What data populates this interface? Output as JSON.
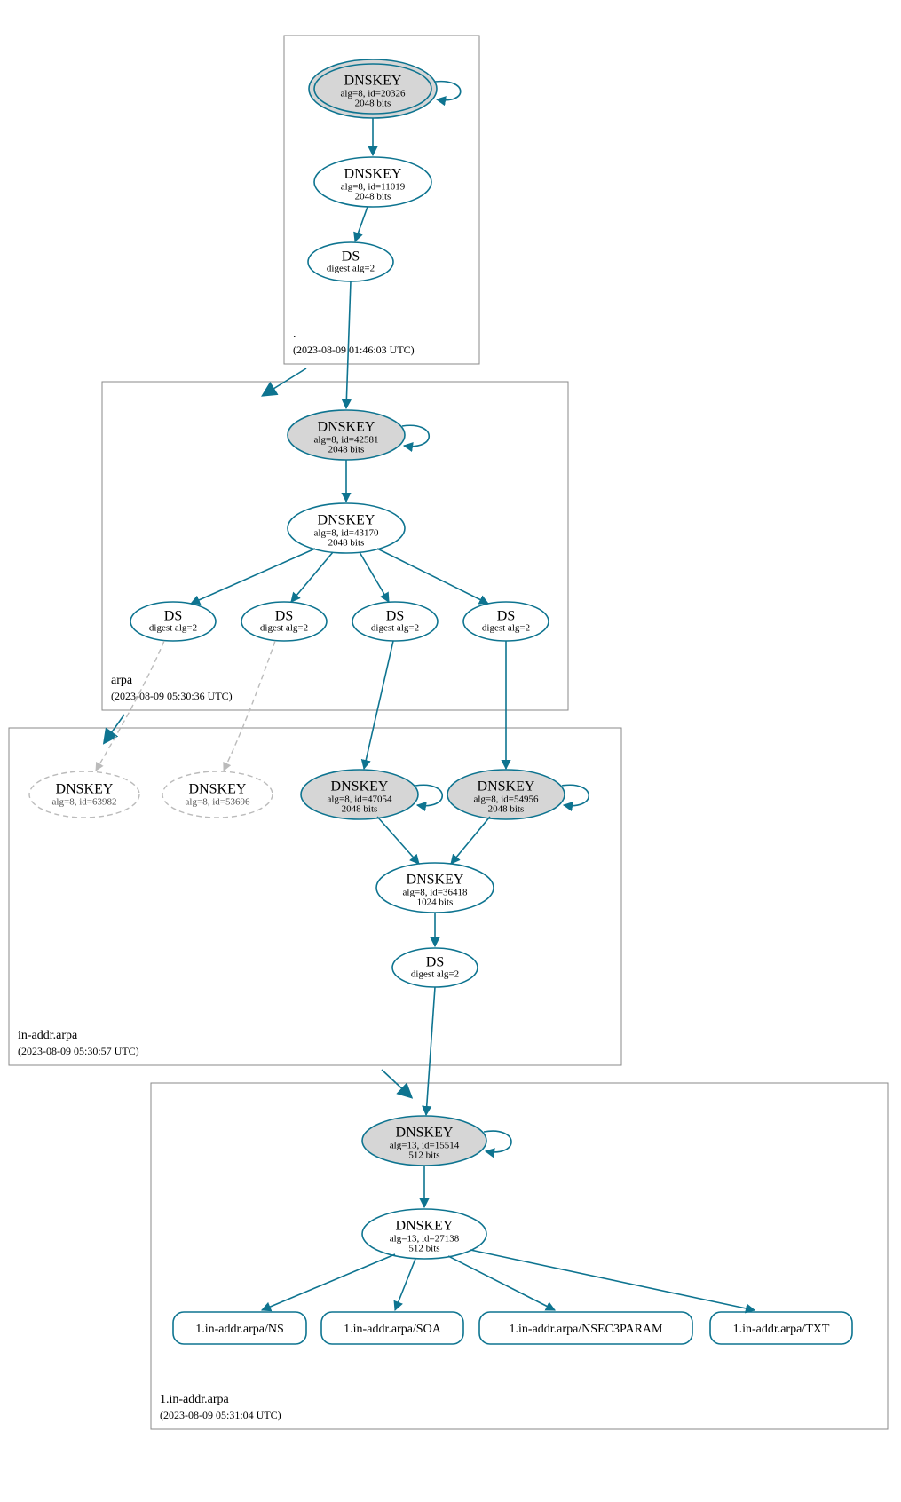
{
  "color_accent": "#0e7490",
  "zones": {
    "root": {
      "name": ".",
      "timestamp": "(2023-08-09 01:46:03 UTC)"
    },
    "arpa": {
      "name": "arpa",
      "timestamp": "(2023-08-09 05:30:36 UTC)"
    },
    "inaddr": {
      "name": "in-addr.arpa",
      "timestamp": "(2023-08-09 05:30:57 UTC)"
    },
    "one": {
      "name": "1.in-addr.arpa",
      "timestamp": "(2023-08-09 05:31:04 UTC)"
    }
  },
  "nodes": {
    "root_ksk": {
      "title": "DNSKEY",
      "l1": "alg=8, id=20326",
      "l2": "2048 bits"
    },
    "root_zsk": {
      "title": "DNSKEY",
      "l1": "alg=8, id=11019",
      "l2": "2048 bits"
    },
    "root_ds": {
      "title": "DS",
      "l1": "digest alg=2"
    },
    "arpa_ksk": {
      "title": "DNSKEY",
      "l1": "alg=8, id=42581",
      "l2": "2048 bits"
    },
    "arpa_zsk": {
      "title": "DNSKEY",
      "l1": "alg=8, id=43170",
      "l2": "2048 bits"
    },
    "arpa_ds1": {
      "title": "DS",
      "l1": "digest alg=2"
    },
    "arpa_ds2": {
      "title": "DS",
      "l1": "digest alg=2"
    },
    "arpa_ds3": {
      "title": "DS",
      "l1": "digest alg=2"
    },
    "arpa_ds4": {
      "title": "DS",
      "l1": "digest alg=2"
    },
    "in_dk1": {
      "title": "DNSKEY",
      "l1": "alg=8, id=63982"
    },
    "in_dk2": {
      "title": "DNSKEY",
      "l1": "alg=8, id=53696"
    },
    "in_ksk1": {
      "title": "DNSKEY",
      "l1": "alg=8, id=47054",
      "l2": "2048 bits"
    },
    "in_ksk2": {
      "title": "DNSKEY",
      "l1": "alg=8, id=54956",
      "l2": "2048 bits"
    },
    "in_zsk": {
      "title": "DNSKEY",
      "l1": "alg=8, id=36418",
      "l2": "1024 bits"
    },
    "in_ds": {
      "title": "DS",
      "l1": "digest alg=2"
    },
    "one_ksk": {
      "title": "DNSKEY",
      "l1": "alg=13, id=15514",
      "l2": "512 bits"
    },
    "one_zsk": {
      "title": "DNSKEY",
      "l1": "alg=13, id=27138",
      "l2": "512 bits"
    },
    "rr_ns": {
      "label": "1.in-addr.arpa/NS"
    },
    "rr_soa": {
      "label": "1.in-addr.arpa/SOA"
    },
    "rr_nsec": {
      "label": "1.in-addr.arpa/NSEC3PARAM"
    },
    "rr_txt": {
      "label": "1.in-addr.arpa/TXT"
    }
  },
  "chart_data": {
    "type": "diagram",
    "description": "DNSSEC chain of trust / authentication graph",
    "zones": [
      {
        "name": ".",
        "timestamp": "2023-08-09 01:46:03 UTC",
        "nodes": [
          "root_ksk",
          "root_zsk",
          "root_ds"
        ]
      },
      {
        "name": "arpa",
        "timestamp": "2023-08-09 05:30:36 UTC",
        "nodes": [
          "arpa_ksk",
          "arpa_zsk",
          "arpa_ds1",
          "arpa_ds2",
          "arpa_ds3",
          "arpa_ds4"
        ]
      },
      {
        "name": "in-addr.arpa",
        "timestamp": "2023-08-09 05:30:57 UTC",
        "nodes": [
          "in_dk1",
          "in_dk2",
          "in_ksk1",
          "in_ksk2",
          "in_zsk",
          "in_ds"
        ]
      },
      {
        "name": "1.in-addr.arpa",
        "timestamp": "2023-08-09 05:31:04 UTC",
        "nodes": [
          "one_ksk",
          "one_zsk",
          "rr_ns",
          "rr_soa",
          "rr_nsec",
          "rr_txt"
        ]
      }
    ],
    "nodes": {
      "root_ksk": {
        "type": "DNSKEY",
        "alg": 8,
        "id": 20326,
        "bits": 2048,
        "ksk": true,
        "trust_anchor": true
      },
      "root_zsk": {
        "type": "DNSKEY",
        "alg": 8,
        "id": 11019,
        "bits": 2048
      },
      "root_ds": {
        "type": "DS",
        "digest_alg": 2
      },
      "arpa_ksk": {
        "type": "DNSKEY",
        "alg": 8,
        "id": 42581,
        "bits": 2048,
        "ksk": true
      },
      "arpa_zsk": {
        "type": "DNSKEY",
        "alg": 8,
        "id": 43170,
        "bits": 2048
      },
      "arpa_ds1": {
        "type": "DS",
        "digest_alg": 2
      },
      "arpa_ds2": {
        "type": "DS",
        "digest_alg": 2
      },
      "arpa_ds3": {
        "type": "DS",
        "digest_alg": 2
      },
      "arpa_ds4": {
        "type": "DS",
        "digest_alg": 2
      },
      "in_dk1": {
        "type": "DNSKEY",
        "alg": 8,
        "id": 63982,
        "status": "unresolved"
      },
      "in_dk2": {
        "type": "DNSKEY",
        "alg": 8,
        "id": 53696,
        "status": "unresolved"
      },
      "in_ksk1": {
        "type": "DNSKEY",
        "alg": 8,
        "id": 47054,
        "bits": 2048,
        "ksk": true
      },
      "in_ksk2": {
        "type": "DNSKEY",
        "alg": 8,
        "id": 54956,
        "bits": 2048,
        "ksk": true
      },
      "in_zsk": {
        "type": "DNSKEY",
        "alg": 8,
        "id": 36418,
        "bits": 1024
      },
      "in_ds": {
        "type": "DS",
        "digest_alg": 2
      },
      "one_ksk": {
        "type": "DNSKEY",
        "alg": 13,
        "id": 15514,
        "bits": 512,
        "ksk": true
      },
      "one_zsk": {
        "type": "DNSKEY",
        "alg": 13,
        "id": 27138,
        "bits": 512
      },
      "rr_ns": {
        "type": "RRset",
        "name": "1.in-addr.arpa/NS"
      },
      "rr_soa": {
        "type": "RRset",
        "name": "1.in-addr.arpa/SOA"
      },
      "rr_nsec": {
        "type": "RRset",
        "name": "1.in-addr.arpa/NSEC3PARAM"
      },
      "rr_txt": {
        "type": "RRset",
        "name": "1.in-addr.arpa/TXT"
      }
    },
    "edges": [
      {
        "from": "root_ksk",
        "to": "root_ksk",
        "kind": "self-sign"
      },
      {
        "from": "root_ksk",
        "to": "root_zsk"
      },
      {
        "from": "root_zsk",
        "to": "root_ds"
      },
      {
        "from": "root_ds",
        "to": "arpa_ksk"
      },
      {
        "from": "arpa_ksk",
        "to": "arpa_ksk",
        "kind": "self-sign"
      },
      {
        "from": "arpa_ksk",
        "to": "arpa_zsk"
      },
      {
        "from": "arpa_zsk",
        "to": "arpa_ds1"
      },
      {
        "from": "arpa_zsk",
        "to": "arpa_ds2"
      },
      {
        "from": "arpa_zsk",
        "to": "arpa_ds3"
      },
      {
        "from": "arpa_zsk",
        "to": "arpa_ds4"
      },
      {
        "from": "arpa_ds1",
        "to": "in_dk1",
        "kind": "unresolved"
      },
      {
        "from": "arpa_ds2",
        "to": "in_dk2",
        "kind": "unresolved"
      },
      {
        "from": "arpa_ds3",
        "to": "in_ksk1"
      },
      {
        "from": "arpa_ds4",
        "to": "in_ksk2"
      },
      {
        "from": "in_ksk1",
        "to": "in_ksk1",
        "kind": "self-sign"
      },
      {
        "from": "in_ksk2",
        "to": "in_ksk2",
        "kind": "self-sign"
      },
      {
        "from": "in_ksk1",
        "to": "in_zsk"
      },
      {
        "from": "in_ksk2",
        "to": "in_zsk"
      },
      {
        "from": "in_zsk",
        "to": "in_ds"
      },
      {
        "from": "in_ds",
        "to": "one_ksk"
      },
      {
        "from": "one_ksk",
        "to": "one_ksk",
        "kind": "self-sign"
      },
      {
        "from": "one_ksk",
        "to": "one_zsk"
      },
      {
        "from": "one_zsk",
        "to": "rr_ns"
      },
      {
        "from": "one_zsk",
        "to": "rr_soa"
      },
      {
        "from": "one_zsk",
        "to": "rr_nsec"
      },
      {
        "from": "one_zsk",
        "to": "rr_txt"
      }
    ]
  }
}
